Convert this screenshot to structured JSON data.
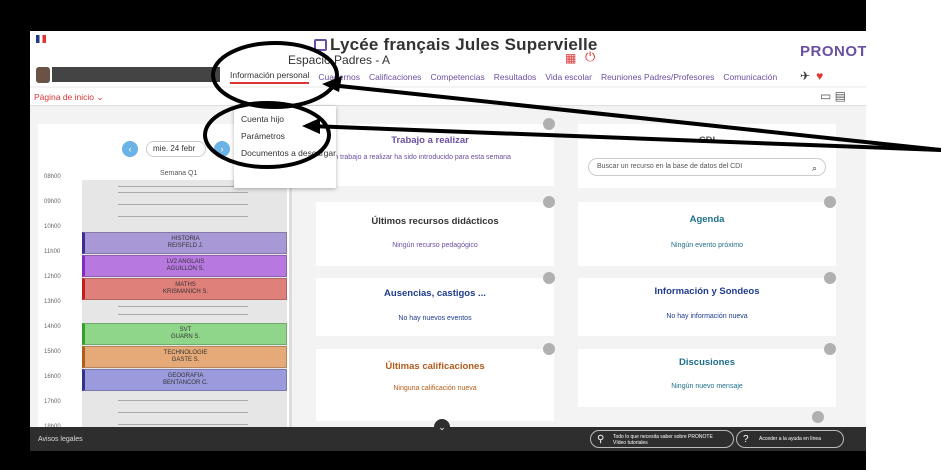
{
  "header": {
    "title": "Lycée français Jules Supervielle",
    "subtitle": "Espacio Padres - A",
    "brand": "PRONOTE"
  },
  "nav": {
    "items": [
      "Información personal",
      "Cuadernos",
      "Calificaciones",
      "Competencias",
      "Resultados",
      "Vida escolar",
      "Reuniones Padres/Profesores",
      "Comunicación"
    ]
  },
  "subbar": {
    "home": "Página de inicio ⌄"
  },
  "dropdown": {
    "items": [
      "Cuenta hijo",
      "Parámetros",
      "Documentos a descargar"
    ]
  },
  "schedule": {
    "date": "mie. 24 febr",
    "week": "Semana Q1",
    "hours": [
      "08h00",
      "09h00",
      "10h00",
      "11h00",
      "12h00",
      "13h00",
      "14h00",
      "15h00",
      "16h00",
      "17h00",
      "18h00"
    ],
    "lessons": [
      {
        "subject": "HISTORIA",
        "teacher": "REISFELD J."
      },
      {
        "subject": "LV2 ANGLAIS",
        "teacher": "AGUILLON S."
      },
      {
        "subject": "MATHS",
        "teacher": "KRISMANICH S."
      },
      {
        "subject": "SVT",
        "teacher": "GUARN S."
      },
      {
        "subject": "TECHNOLOGIE",
        "teacher": "GASTE S."
      },
      {
        "subject": "GEOGRAFIA",
        "teacher": "BENTANCOR C."
      }
    ]
  },
  "cards": {
    "trabajo": {
      "title": "Trabajo a realizar",
      "text": "Ningún trabajo a realizar ha sido introducido para esta semana"
    },
    "cdi": {
      "title": "CDI",
      "placeholder": "Buscar un recurso en la base de datos del CDI"
    },
    "recursos": {
      "title": "Últimos recursos didácticos",
      "text": "Ningún recurso pedagógico"
    },
    "agenda": {
      "title": "Agenda",
      "text": "Ningún evento próximo"
    },
    "ausencias": {
      "title": "Ausencias, castigos ...",
      "text": "No hay nuevos eventos"
    },
    "info": {
      "title": "Información y Sondeos",
      "text": "No hay información nueva"
    },
    "calificaciones": {
      "title": "Últimas calificaciones",
      "text": "Ninguna calificación nueva"
    },
    "discusiones": {
      "title": "Discusiones",
      "text": "Ningún nuevo mensaje"
    }
  },
  "footer": {
    "legal": "Avisos legales",
    "help1_line1": "Todo lo que necesita saber sobre PRONOTE",
    "help1_line2": "Vídeo tutoriales",
    "help2": "Acceder a la ayuda en línea"
  },
  "colors": {
    "accent": "#6b4fa0",
    "brand_red": "#d33333",
    "footer_bg": "#2e2e2e"
  }
}
